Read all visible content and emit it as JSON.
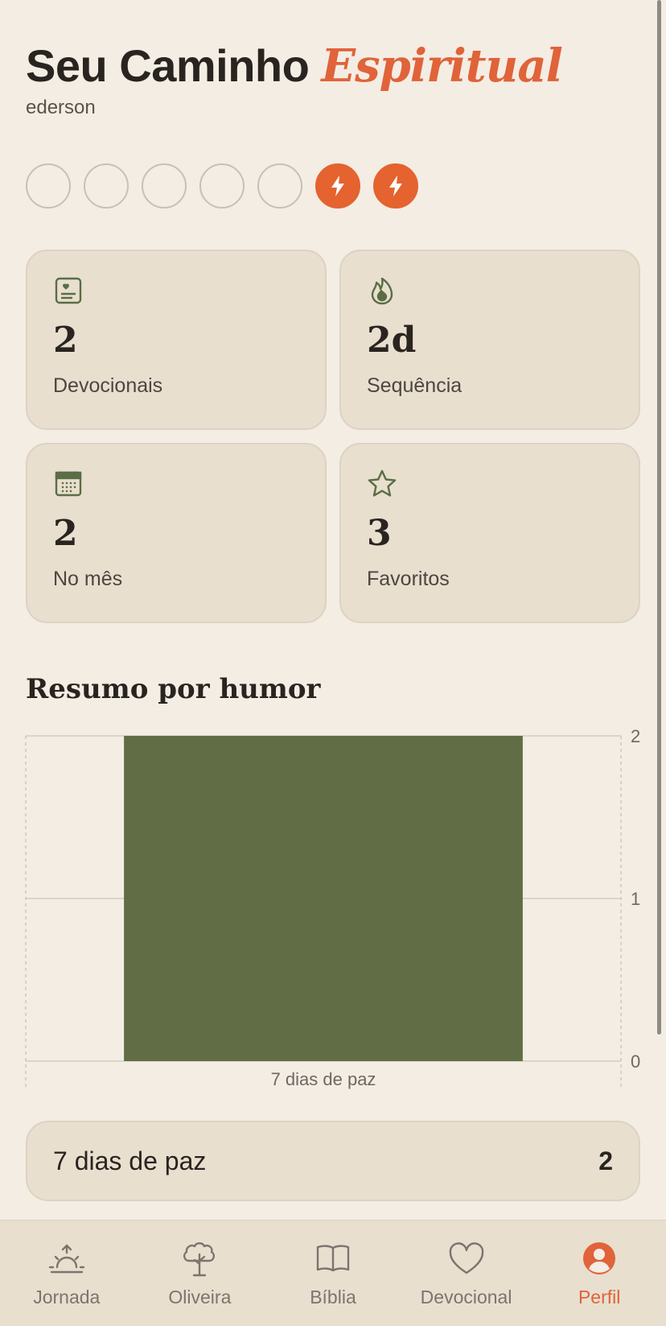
{
  "header": {
    "title_main": "Seu Caminho",
    "title_accent": "Espiritual",
    "username": "ederson"
  },
  "week": {
    "days": [
      {
        "active": false
      },
      {
        "active": false
      },
      {
        "active": false
      },
      {
        "active": false
      },
      {
        "active": false
      },
      {
        "active": true
      },
      {
        "active": true
      }
    ],
    "active_icon": "lightning-icon"
  },
  "stats": [
    {
      "icon": "devotional-icon",
      "value": "2",
      "label": "Devocionais"
    },
    {
      "icon": "flame-icon",
      "value": "2d",
      "label": "Sequência"
    },
    {
      "icon": "calendar-icon",
      "value": "2",
      "label": "No mês"
    },
    {
      "icon": "star-icon",
      "value": "3",
      "label": "Favoritos"
    }
  ],
  "mood_section": {
    "title": "Resumo por humor"
  },
  "chart_data": {
    "type": "bar",
    "categories": [
      "7 dias de paz"
    ],
    "values": [
      2
    ],
    "ylim": [
      0,
      2
    ],
    "yticks": [
      0,
      1,
      2
    ],
    "ylabel_position": "right",
    "bar_color": "#616e45",
    "grid": true
  },
  "summary": {
    "label": "7 dias de paz",
    "value": "2"
  },
  "nav": {
    "items": [
      {
        "label": "Jornada",
        "icon": "sunrise-icon"
      },
      {
        "label": "Oliveira",
        "icon": "tree-icon"
      },
      {
        "label": "Bíblia",
        "icon": "book-icon"
      },
      {
        "label": "Devocional",
        "icon": "heart-icon"
      },
      {
        "label": "Perfil",
        "icon": "profile-icon",
        "active": true
      }
    ]
  },
  "colors": {
    "accent": "#e0633a",
    "background": "#f3ede4",
    "card": "#e8dfcf",
    "icon_green": "#5b6d45"
  }
}
